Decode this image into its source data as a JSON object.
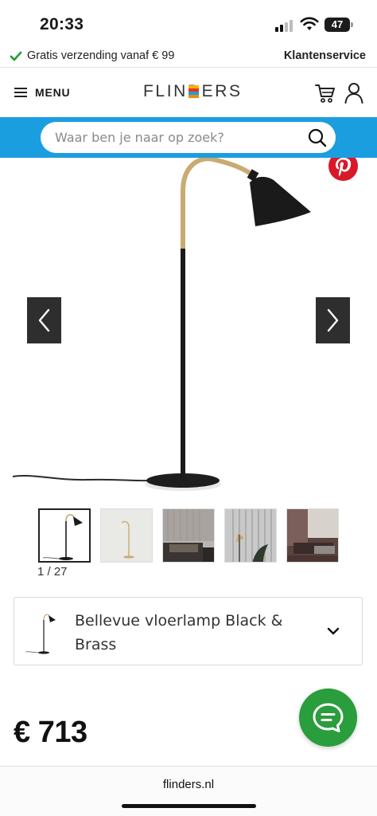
{
  "status_bar": {
    "time": "20:33",
    "battery_level": "47"
  },
  "usp_bar": {
    "shipping_text": "Gratis verzending vanaf € 99",
    "service_link": "Klantenservice",
    "check_color": "#2a9d3c"
  },
  "header": {
    "menu_label": "MENU",
    "logo_text": "FLINDERS"
  },
  "search": {
    "placeholder": "Waar ben je naar op zoek?",
    "band_color": "#1b9ee0"
  },
  "gallery": {
    "counter": "1 / 27",
    "current_index": 1,
    "total_images": 27,
    "thumbnails": [
      {
        "name": "thumb-lamp-white"
      },
      {
        "name": "thumb-lamp-beige"
      },
      {
        "name": "thumb-bedroom"
      },
      {
        "name": "thumb-lamp-dark-wall"
      },
      {
        "name": "thumb-living-room"
      }
    ]
  },
  "product": {
    "variant_name": "Bellevue vloerlamp Black & Brass",
    "price": "€ 713"
  },
  "browser": {
    "url": "flinders.nl"
  },
  "colors": {
    "brand_blue": "#1b9ee0",
    "chat_green": "#2a9d3c",
    "pinterest_red": "#d8192a"
  }
}
